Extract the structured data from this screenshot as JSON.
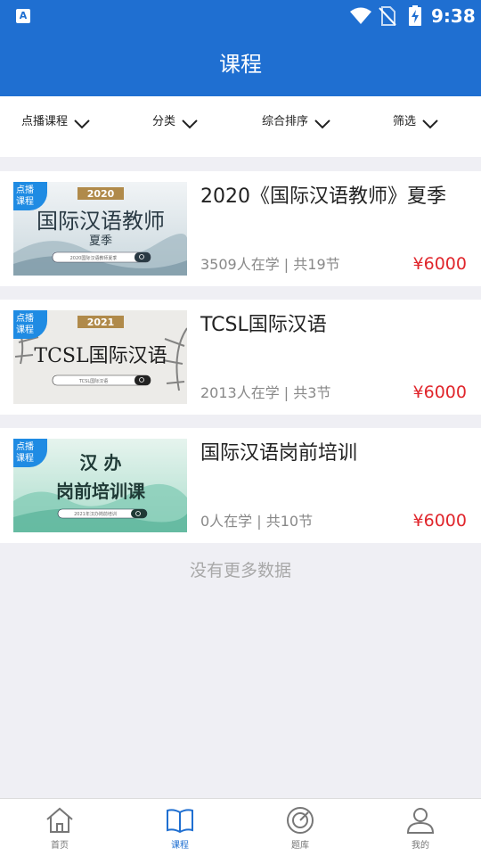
{
  "status_bar": {
    "app_icon": "A",
    "time": "9:38",
    "icons": [
      "wifi-icon",
      "no-sim-icon",
      "battery-charging-icon"
    ]
  },
  "header": {
    "title": "课程"
  },
  "filters": [
    {
      "label": "点播课程",
      "icon": "chevron-down-icon"
    },
    {
      "label": "分类",
      "icon": "chevron-down-icon"
    },
    {
      "label": "综合排序",
      "icon": "chevron-down-icon"
    },
    {
      "label": "筛选",
      "icon": "chevron-down-icon"
    }
  ],
  "courses": [
    {
      "badge": "点播课程",
      "badge_lines": [
        "点播",
        "课程"
      ],
      "thumb_year": "2020",
      "thumb_title": "国际汉语教师",
      "thumb_subtitle": "夏季",
      "thumb_searchbar": "2020国际汉语教师夏季",
      "title": "2020《国际汉语教师》夏季",
      "meta": "3509人在学 | 共19节",
      "price": "¥6000"
    },
    {
      "badge": "点播课程",
      "badge_lines": [
        "点播",
        "课程"
      ],
      "thumb_year": "2021",
      "thumb_title": "TCSL国际汉语",
      "thumb_subtitle": "",
      "thumb_searchbar": "TCSL国际汉语",
      "title": "TCSL国际汉语",
      "meta": "2013人在学 | 共3节",
      "price": "¥6000"
    },
    {
      "badge": "点播课程",
      "badge_lines": [
        "点播",
        "课程"
      ],
      "thumb_year": "",
      "thumb_title": "汉 办",
      "thumb_subtitle": "岗前培训课",
      "thumb_searchbar": "2021年汉办岗前培训",
      "title": "国际汉语岗前培训",
      "meta": "0人在学 | 共10节",
      "price": "¥6000"
    }
  ],
  "list_footer": "没有更多数据",
  "bottom_nav": [
    {
      "label": "首页",
      "icon": "home-icon",
      "active": false
    },
    {
      "label": "课程",
      "icon": "book-icon",
      "active": true
    },
    {
      "label": "题库",
      "icon": "target-icon",
      "active": false
    },
    {
      "label": "我的",
      "icon": "user-icon",
      "active": false
    }
  ],
  "colors": {
    "primary": "#1f6fd1",
    "price": "#e0262c",
    "badge": "#1f8be3",
    "background": "#efeff4"
  }
}
